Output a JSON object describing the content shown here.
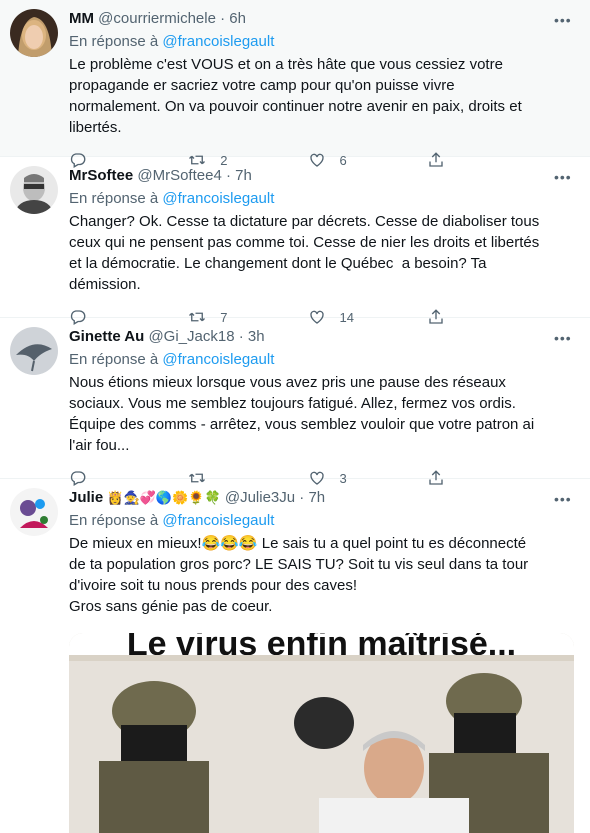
{
  "tweets": [
    {
      "name": "MM",
      "handle": "@courriermichele",
      "time": "6h",
      "reply_prefix": "En réponse à",
      "reply_to": "@francoislegault",
      "text": "Le problème c'est VOUS et on a très hâte que vous cessiez votre propagande er sacriez votre camp pour qu'on puisse vivre normalement. On va pouvoir continuer notre avenir en paix, droits et libertés.",
      "replies": "",
      "retweets": "2",
      "likes": "6"
    },
    {
      "name": "MrSoftee",
      "handle": "@MrSoftee4",
      "time": "7h",
      "reply_prefix": "",
      "reply_to": "",
      "text": "Changer? Ok. Cesse ta dictature par décrets. Cesse de diaboliser tous ceux qui ne pensent pas comme toi. Cesse de nier les droits et libertés et la démocratie. Le changement dont le Québec  a besoin? Ta démission.",
      "replies": "",
      "retweets": "7",
      "likes": "14"
    },
    {
      "name": "Ginette Au",
      "handle": "@Gi_Jack18",
      "time": "3h",
      "reply_prefix": "En réponse à",
      "reply_to": "@francoislegault",
      "text": "Nous étions mieux lorsque vous avez pris une pause des réseaux sociaux. Vous me semblez toujours fatigué. Allez, fermez vos ordis. Équipe des comms - arrêtez, vous semblez vouloir que votre patron ai l'air fou...",
      "replies": "",
      "retweets": "",
      "likes": "3"
    },
    {
      "name": "Julie",
      "name_emojis": "👸🧙💞🌎🌼🌻🍀",
      "handle": "@Julie3Ju",
      "time": "7h",
      "reply_prefix": "En réponse à",
      "reply_to": "@francoislegault",
      "text": "De mieux en mieux!😂😂😂 Le sais tu a quel point tu es déconnecté de ta population gros porc? LE SAIS TU? Soit tu vis seul dans ta tour d'ivoire soit tu nous prends pour des caves!\nGros sans génie pas de coeur.",
      "media_caption": "Le virus enfin maîtrisé..."
    }
  ],
  "separator": "·",
  "colors": {
    "link": "#1d9bf0",
    "muted": "#536471",
    "highlight_bg": "#f7f9f9"
  }
}
